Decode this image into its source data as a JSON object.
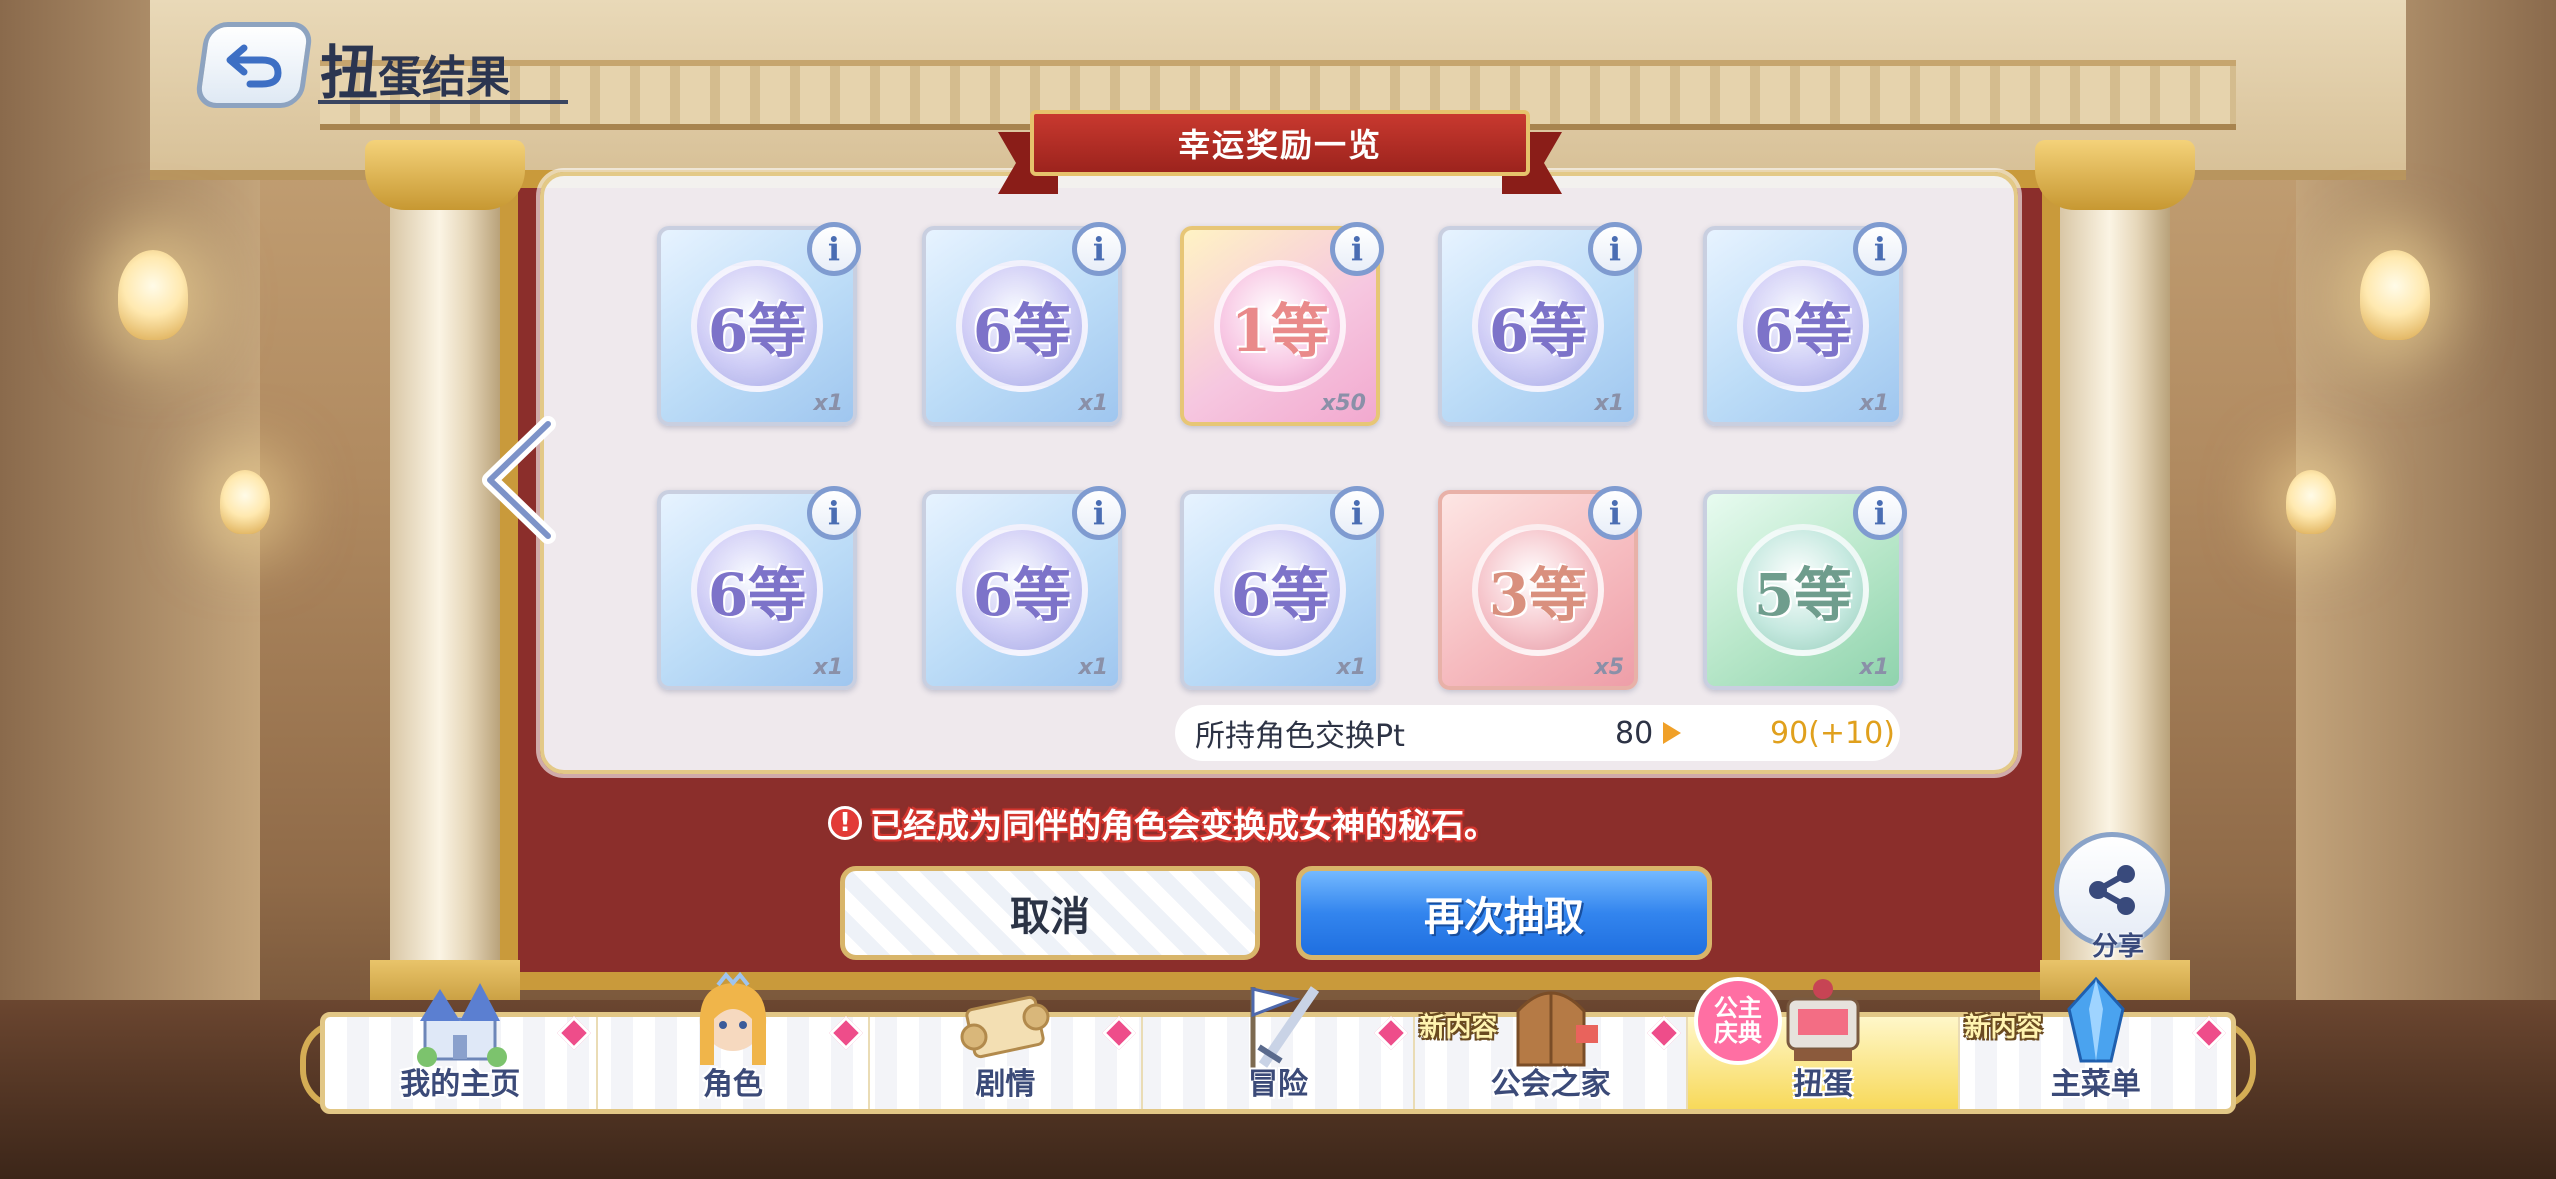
{
  "header": {
    "title_first": "扭",
    "title_rest": "蛋结果"
  },
  "banner": {
    "title": "幸运奖励一览"
  },
  "rewards": [
    {
      "grade": "6等",
      "qty": "x1",
      "style": "blue"
    },
    {
      "grade": "6等",
      "qty": "x1",
      "style": "blue"
    },
    {
      "grade": "1等",
      "qty": "x50",
      "style": "gold"
    },
    {
      "grade": "6等",
      "qty": "x1",
      "style": "blue"
    },
    {
      "grade": "6等",
      "qty": "x1",
      "style": "blue"
    },
    {
      "grade": "6等",
      "qty": "x1",
      "style": "blue"
    },
    {
      "grade": "6等",
      "qty": "x1",
      "style": "blue"
    },
    {
      "grade": "6等",
      "qty": "x1",
      "style": "blue"
    },
    {
      "grade": "3等",
      "qty": "x5",
      "style": "pink"
    },
    {
      "grade": "5等",
      "qty": "x1",
      "style": "green"
    }
  ],
  "exchange_pt": {
    "label": "所持角色交换Pt",
    "from": "80",
    "to": "90(+10)"
  },
  "notice": {
    "icon": "!",
    "text": "已经成为同伴的角色会变换成女神的秘石。"
  },
  "buttons": {
    "cancel": "取消",
    "draw_again": "再次抽取"
  },
  "share": {
    "label": "分享"
  },
  "bottom_nav": [
    {
      "label": "我的主页",
      "badge": "",
      "icon": "castle-icon"
    },
    {
      "label": "角色",
      "badge": "",
      "icon": "character-icon"
    },
    {
      "label": "剧情",
      "badge": "",
      "icon": "scroll-icon"
    },
    {
      "label": "冒险",
      "badge": "",
      "icon": "sword-flag-icon"
    },
    {
      "label": "公会之家",
      "badge": "新内容",
      "icon": "guild-door-icon"
    },
    {
      "label": "扭蛋",
      "badge": "公主庆典",
      "icon": "gacha-icon",
      "active": true
    },
    {
      "label": "主菜单",
      "badge": "新内容",
      "icon": "crystal-icon"
    }
  ],
  "colors": {
    "accent_blue": "#3385ee",
    "banner_red": "#c8392f",
    "notice_red": "#d3362f",
    "pt_gold": "#e0a01d",
    "frame_gold": "#e2c786"
  }
}
